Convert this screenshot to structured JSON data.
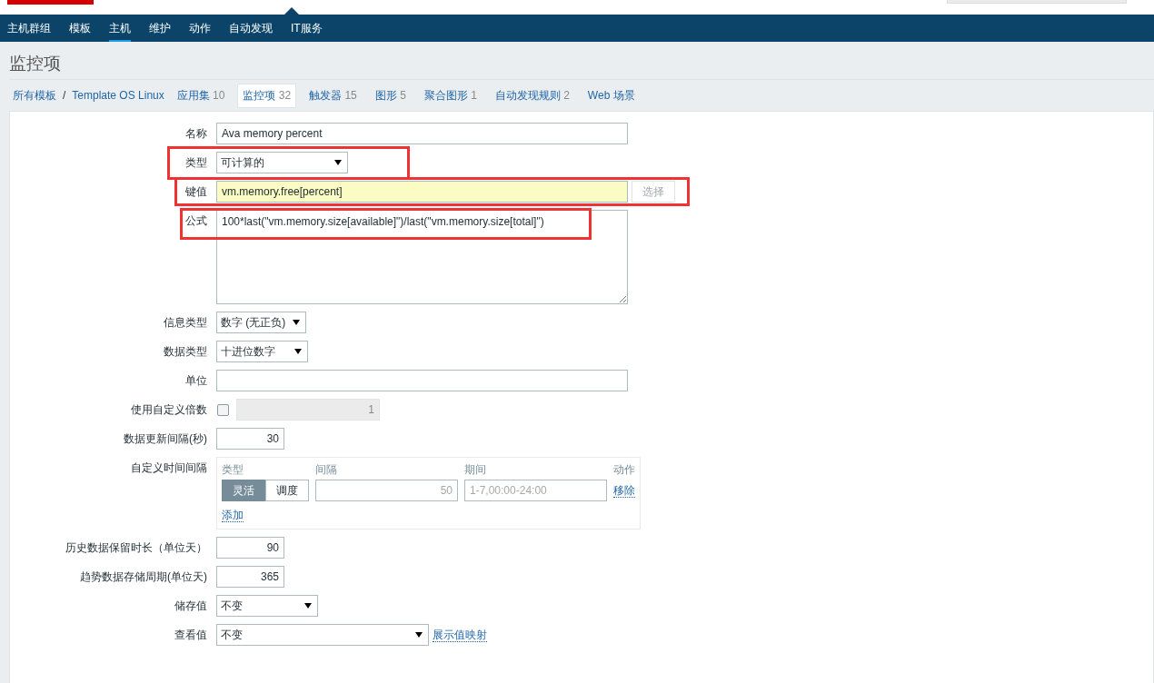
{
  "nav": [
    {
      "label": "主机群组",
      "selected": false
    },
    {
      "label": "模板",
      "selected": false
    },
    {
      "label": "主机",
      "selected": true
    },
    {
      "label": "维护",
      "selected": false
    },
    {
      "label": "动作",
      "selected": false
    },
    {
      "label": "自动发现",
      "selected": false
    },
    {
      "label": "IT服务",
      "selected": false
    }
  ],
  "page_title": "监控项",
  "breadcrumbs": [
    {
      "label": "所有模板"
    },
    {
      "label": "Template OS Linux"
    }
  ],
  "breadcrumb_separator": "/",
  "tabs": [
    {
      "label": "应用集",
      "count": "10",
      "selected": false
    },
    {
      "label": "监控项",
      "count": "32",
      "selected": true
    },
    {
      "label": "触发器",
      "count": "15",
      "selected": false
    },
    {
      "label": "图形",
      "count": "5",
      "selected": false
    },
    {
      "label": "聚合图形",
      "count": "1",
      "selected": false
    },
    {
      "label": "自动发现规则",
      "count": "2",
      "selected": false
    },
    {
      "label": "Web 场景",
      "selected": false
    }
  ],
  "form": {
    "rows": [
      {
        "kind": "text",
        "label": "名称",
        "value": "Ava memory percent",
        "highlighted": false
      },
      {
        "kind": "select",
        "label": "类型",
        "value": "可计算的",
        "highlighted": true
      },
      {
        "kind": "key",
        "label": "键值",
        "value": "vm.memory.free[percent]",
        "button": "选择",
        "highlighted": true
      },
      {
        "kind": "textarea",
        "label": "公式",
        "value": "100*last(\"vm.memory.size[available]\")/last(\"vm.memory.size[total]\")",
        "highlighted": true
      },
      {
        "kind": "select",
        "label": "信息类型",
        "value": "数字 (无正负)",
        "highlighted": false
      },
      {
        "kind": "select",
        "label": "数据类型",
        "value": "十进位数字",
        "highlighted": false
      },
      {
        "kind": "text",
        "label": "单位",
        "highlighted": false
      },
      {
        "kind": "multiplier",
        "label": "使用自定义倍数",
        "checked": false,
        "value": "1",
        "highlighted": false
      },
      {
        "kind": "number",
        "label": "数据更新间隔(秒)",
        "value": "30",
        "highlighted": false
      },
      {
        "kind": "intervals",
        "label": "自定义时间间隔",
        "columns": [
          "类型",
          "间隔",
          "期间",
          "动作"
        ],
        "rows": [
          {
            "modes": [
              {
                "label": "灵活",
                "selected": true
              },
              {
                "label": "调度",
                "selected": false
              }
            ],
            "interval_placeholder": "50",
            "period_placeholder": "1-7,00:00-24:00",
            "action": "移除"
          }
        ],
        "add": "添加",
        "highlighted": false
      },
      {
        "kind": "number",
        "label": "历史数据保留时长（单位天）",
        "value": "90",
        "highlighted": false
      },
      {
        "kind": "number",
        "label": "趋势数据存储周期(单位天)",
        "value": "365",
        "highlighted": false
      },
      {
        "kind": "select",
        "label": "储存值",
        "value": "不变",
        "highlighted": false
      },
      {
        "kind": "select",
        "label": "查看值",
        "value": "不变",
        "link": "展示值映射",
        "highlighted": false
      }
    ]
  }
}
